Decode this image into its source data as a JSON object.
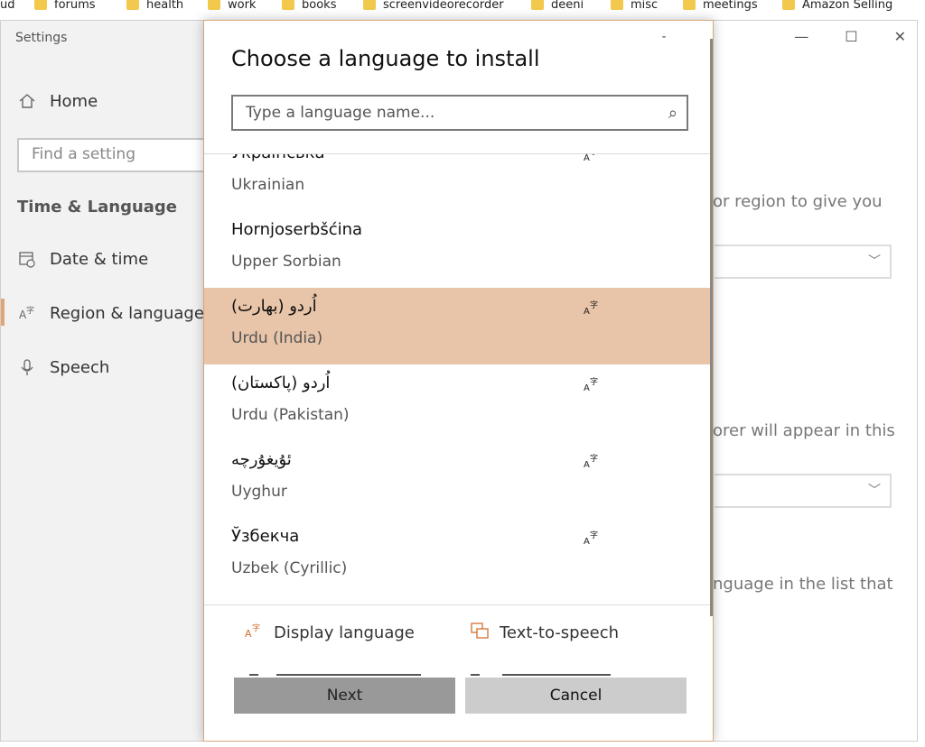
{
  "bookmarks": [
    {
      "label": "ud"
    },
    {
      "label": "forums"
    },
    {
      "label": "health"
    },
    {
      "label": "work"
    },
    {
      "label": "books"
    },
    {
      "label": "screenvideorecorder"
    },
    {
      "label": "deeni"
    },
    {
      "label": "misc"
    },
    {
      "label": "meetings"
    },
    {
      "label": "Amazon Selling"
    }
  ],
  "settings": {
    "title": "Settings",
    "nav": {
      "home": "Home",
      "date_time": "Date & time",
      "region_language": "Region & language",
      "speech": "Speech"
    },
    "search_placeholder": "Find a setting",
    "section": "Time & Language",
    "bg_text_1": "or region to give you",
    "bg_text_2": "orer will appear in this",
    "bg_text_3": "nguage in the list that"
  },
  "dialog": {
    "title": "Choose a language to install",
    "search_placeholder": "Type a language name...",
    "languages": [
      {
        "native": "Українська",
        "english": "Ukrainian",
        "has_feature": true,
        "selected": false
      },
      {
        "native": "Hornjoserbšćina",
        "english": "Upper Sorbian",
        "has_feature": false,
        "selected": false
      },
      {
        "native": "اُردو (بھارت)",
        "english": "Urdu (India)",
        "has_feature": true,
        "selected": true
      },
      {
        "native": "اُردو (پاکستان)",
        "english": "Urdu (Pakistan)",
        "has_feature": true,
        "selected": false
      },
      {
        "native": "ئۇيغۇرچە",
        "english": "Uyghur",
        "has_feature": true,
        "selected": false
      },
      {
        "native": "Ўзбекча",
        "english": "Uzbek (Cyrillic)",
        "has_feature": true,
        "selected": false
      }
    ],
    "feature_icon_glyph": "A字",
    "features": {
      "display_language": "Display language",
      "text_to_speech": "Text-to-speech"
    },
    "buttons": {
      "next": "Next",
      "cancel": "Cancel"
    }
  },
  "colors": {
    "accent": "#d16f2e",
    "selected_row": "#e8c4a8",
    "dialog_border": "#d9a67c"
  }
}
